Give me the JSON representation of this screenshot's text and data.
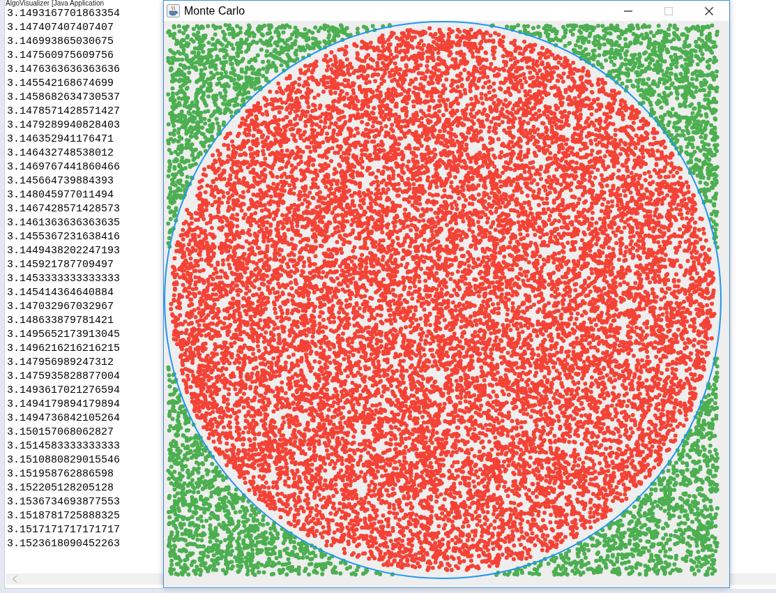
{
  "console": {
    "title": "AlgoVisualizer [Java Application",
    "lines": [
      "3.1493167701863354",
      "3.147407407407407",
      "3.146993865030675",
      "3.147560975609756",
      "3.1476363636363636",
      "3.145542168674699",
      "3.1458682634730537",
      "3.1478571428571427",
      "3.1479289940828403",
      "3.146352941176471",
      "3.146432748538012",
      "3.1469767441860466",
      "3.145664739884393",
      "3.148045977011494",
      "3.1467428571428573",
      "3.1461363636363635",
      "3.1455367231638416",
      "3.1449438202247193",
      "3.145921787709497",
      "3.1453333333333333",
      "3.145414364640884",
      "3.147032967032967",
      "3.148633879781421",
      "3.1495652173913045",
      "3.1496216216216215",
      "3.147956989247312",
      "3.1475935828877004",
      "3.1493617021276594",
      "3.1494179894179894",
      "3.1494736842105264",
      "3.150157068062827",
      "3.1514583333333333",
      "3.1510880829015546",
      "3.151958762886598",
      "3.152205128205128",
      "3.1536734693877553",
      "3.1518781725888325",
      "3.1517171717171717",
      "3.1523618090452263"
    ]
  },
  "window": {
    "title": "Monte Carlo",
    "controls": [
      {
        "kind": "minimize",
        "disabled": false
      },
      {
        "kind": "maximize",
        "disabled": true
      },
      {
        "kind": "close",
        "disabled": false
      }
    ]
  }
}
